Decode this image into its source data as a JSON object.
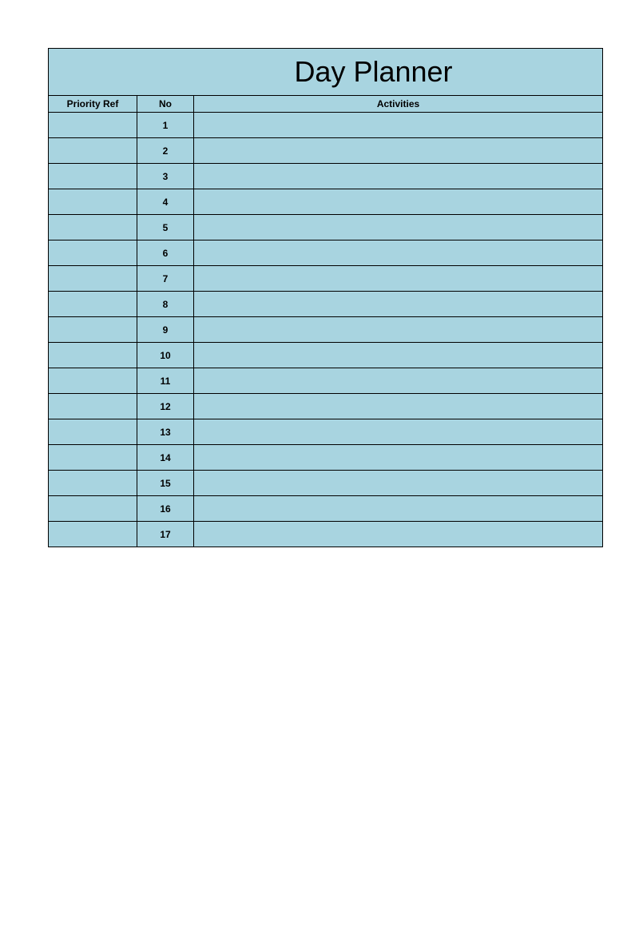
{
  "title": "Day Planner",
  "columns": {
    "priority": "Priority Ref",
    "no": "No",
    "activities": "Activities"
  },
  "rows": [
    {
      "priority": "",
      "no": "1",
      "activities": ""
    },
    {
      "priority": "",
      "no": "2",
      "activities": ""
    },
    {
      "priority": "",
      "no": "3",
      "activities": ""
    },
    {
      "priority": "",
      "no": "4",
      "activities": ""
    },
    {
      "priority": "",
      "no": "5",
      "activities": ""
    },
    {
      "priority": "",
      "no": "6",
      "activities": ""
    },
    {
      "priority": "",
      "no": "7",
      "activities": ""
    },
    {
      "priority": "",
      "no": "8",
      "activities": ""
    },
    {
      "priority": "",
      "no": "9",
      "activities": ""
    },
    {
      "priority": "",
      "no": "10",
      "activities": ""
    },
    {
      "priority": "",
      "no": "11",
      "activities": ""
    },
    {
      "priority": "",
      "no": "12",
      "activities": ""
    },
    {
      "priority": "",
      "no": "13",
      "activities": ""
    },
    {
      "priority": "",
      "no": "14",
      "activities": ""
    },
    {
      "priority": "",
      "no": "15",
      "activities": ""
    },
    {
      "priority": "",
      "no": "16",
      "activities": ""
    },
    {
      "priority": "",
      "no": "17",
      "activities": ""
    }
  ]
}
